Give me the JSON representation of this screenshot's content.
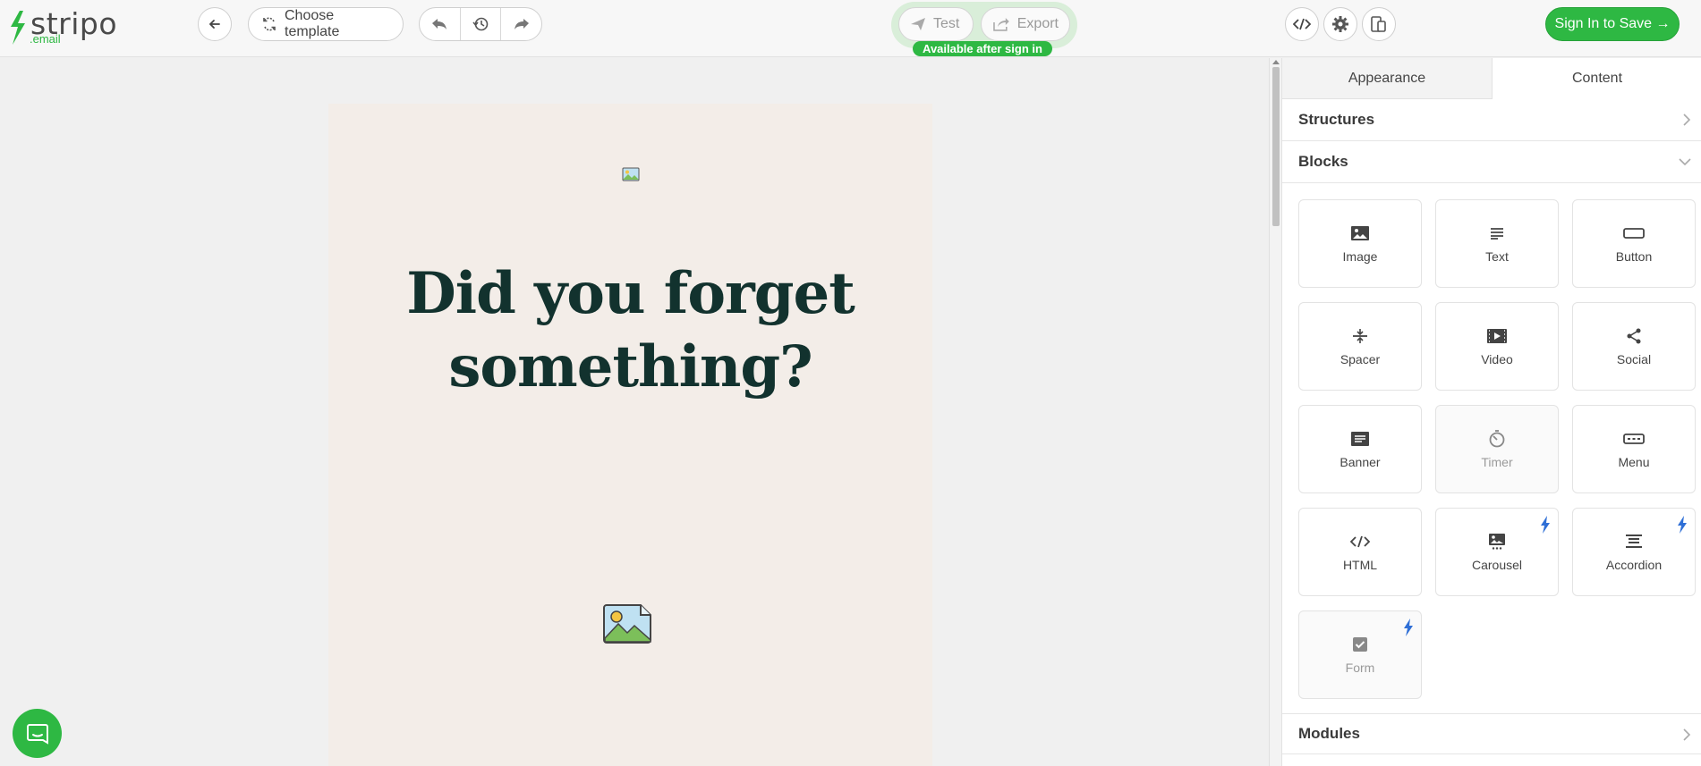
{
  "brand": {
    "name": "stripo",
    "sub": ".email",
    "accent": "#2eb843"
  },
  "toolbar": {
    "choose_template": "Choose template",
    "test_label": "Test",
    "export_label": "Export",
    "available_badge": "Available after sign in",
    "signin_label": "Sign In to Save →"
  },
  "email": {
    "headline_line1": "Did you forget",
    "headline_line2": "something?"
  },
  "panel": {
    "tabs": [
      {
        "label": "Appearance",
        "active": false
      },
      {
        "label": "Content",
        "active": true
      }
    ],
    "sections": {
      "structures": "Structures",
      "blocks": "Blocks",
      "modules": "Modules"
    },
    "blocks": [
      {
        "label": "Image",
        "icon": "image-icon"
      },
      {
        "label": "Text",
        "icon": "text-icon"
      },
      {
        "label": "Button",
        "icon": "button-icon"
      },
      {
        "label": "Spacer",
        "icon": "spacer-icon"
      },
      {
        "label": "Video",
        "icon": "video-icon"
      },
      {
        "label": "Social",
        "icon": "share-icon"
      },
      {
        "label": "Banner",
        "icon": "banner-icon"
      },
      {
        "label": "Timer",
        "icon": "timer-icon",
        "disabled": true
      },
      {
        "label": "Menu",
        "icon": "menu-icon"
      },
      {
        "label": "HTML",
        "icon": "code-icon"
      },
      {
        "label": "Carousel",
        "icon": "carousel-icon",
        "pro": true
      },
      {
        "label": "Accordion",
        "icon": "accordion-icon",
        "pro": true
      },
      {
        "label": "Form",
        "icon": "form-icon",
        "pro": true,
        "disabled": true
      }
    ]
  }
}
